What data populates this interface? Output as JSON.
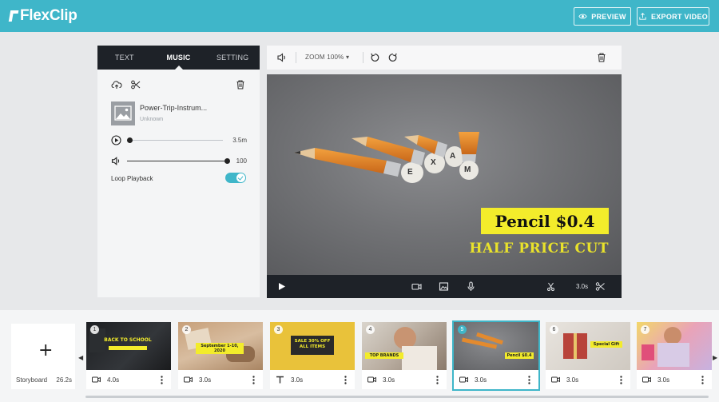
{
  "header": {
    "logo": "FlexClip",
    "preview_label": "PREVIEW",
    "export_label": "EXPORT VIDEO"
  },
  "left_panel": {
    "tabs": [
      {
        "label": "TEXT",
        "active": false
      },
      {
        "label": "MUSIC",
        "active": true
      },
      {
        "label": "SETTING",
        "active": false
      }
    ],
    "track": {
      "name": "Power-Trip-Instrum...",
      "artist": "Unknown"
    },
    "playback": {
      "value_label": "3.5m",
      "position": 0.0
    },
    "volume": {
      "value_label": "100",
      "level": 1.0
    },
    "loop": {
      "label": "Loop Playback",
      "enabled": true
    }
  },
  "preview": {
    "zoom_label": "ZOOM",
    "zoom_value": "100%",
    "headline": "Pencil $0.4",
    "subline": "HALF PRICE CUT",
    "pencil_letters": [
      "E",
      "X",
      "A",
      "M"
    ],
    "duration": "3.0s"
  },
  "timeline": {
    "storyboard_label": "Storyboard",
    "storyboard_duration": "26.2s",
    "clips": [
      {
        "num": "1",
        "type": "video",
        "duration": "4.0s",
        "tag": "BACK TO SCHOOL",
        "active": false
      },
      {
        "num": "2",
        "type": "video",
        "duration": "3.0s",
        "tag": "September 1-10, 2020",
        "active": false
      },
      {
        "num": "3",
        "type": "text",
        "duration": "3.0s",
        "tag": "SALE 30% OFF ALL ITEMS",
        "active": false
      },
      {
        "num": "4",
        "type": "video",
        "duration": "3.0s",
        "tag": "TOP BRANDS",
        "active": false
      },
      {
        "num": "5",
        "type": "video",
        "duration": "3.0s",
        "tag": "Pencil $0.4",
        "active": true
      },
      {
        "num": "6",
        "type": "video",
        "duration": "3.0s",
        "tag": "Special Gift",
        "active": false
      },
      {
        "num": "7",
        "type": "video",
        "duration": "3.0s",
        "tag": "",
        "active": false
      }
    ]
  },
  "colors": {
    "accent": "#3fb6c9",
    "dark": "#1e2228",
    "highlight_yellow": "#f3ec2b"
  }
}
